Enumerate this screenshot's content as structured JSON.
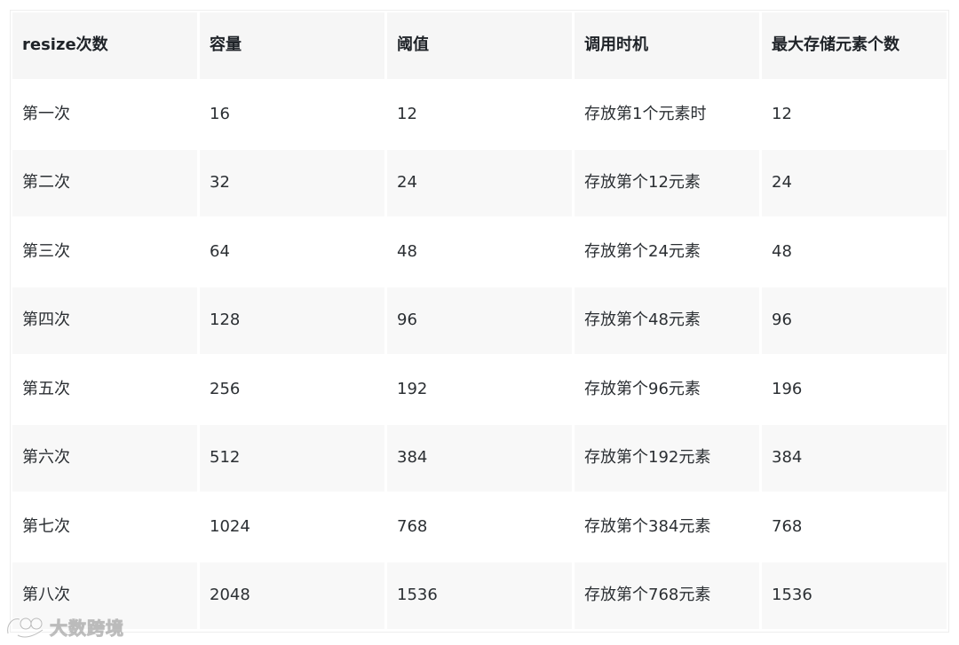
{
  "table": {
    "headers": [
      "resize次数",
      "容量",
      "阈值",
      "调用时机",
      "最大存储元素个数"
    ],
    "rows": [
      [
        "第一次",
        "16",
        "12",
        "存放第1个元素时",
        "12"
      ],
      [
        "第二次",
        "32",
        "24",
        "存放第个12元素",
        "24"
      ],
      [
        "第三次",
        "64",
        "48",
        "存放第个24元素",
        "48"
      ],
      [
        "第四次",
        "128",
        "96",
        "存放第个48元素",
        "96"
      ],
      [
        "第五次",
        "256",
        "192",
        "存放第个96元素",
        "196"
      ],
      [
        "第六次",
        "512",
        "384",
        "存放第个192元素",
        "384"
      ],
      [
        "第七次",
        "1024",
        "768",
        "存放第个384元素",
        "768"
      ],
      [
        "第八次",
        "2048",
        "1536",
        "存放第个768元素",
        "1536"
      ]
    ]
  },
  "watermark": {
    "text": "大数跨境"
  }
}
